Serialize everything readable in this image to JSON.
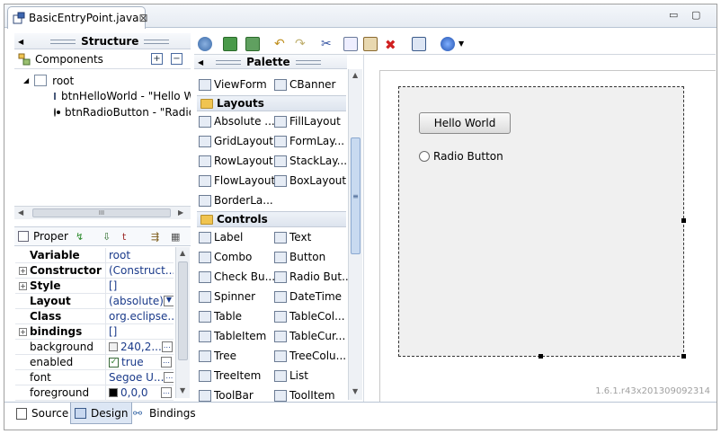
{
  "editor": {
    "tab_title": "BasicEntryPoint.java",
    "close_glyph": "⊠",
    "minimize_glyph": "▭",
    "maximize_glyph": "▢"
  },
  "structure": {
    "title": "Structure",
    "components_label": "Components",
    "tree": {
      "root_label": "root",
      "children": [
        {
          "label": "btnHelloWorld - \"Hello W",
          "icon": "button-icon"
        },
        {
          "label": "btnRadioButton - \"Radio",
          "icon": "radio-icon"
        }
      ]
    },
    "hscroll_grip": "III"
  },
  "properties": {
    "title": "Proper",
    "rows": [
      {
        "name": "Variable",
        "value": "root",
        "bold": true,
        "expand": false
      },
      {
        "name": "Constructor",
        "value": "(Construct...",
        "bold": true,
        "expand": true
      },
      {
        "name": "Style",
        "value": "[]",
        "bold": true,
        "expand": true
      },
      {
        "name": "Layout",
        "value": "(absolute)",
        "bold": true,
        "expand": false,
        "dropdown": true
      },
      {
        "name": "Class",
        "value": "org.eclipse....",
        "bold": true,
        "expand": false
      },
      {
        "name": "bindings",
        "value": "[]",
        "bold": true,
        "expand": true
      },
      {
        "name": "background",
        "value": "240,2...",
        "bold": false,
        "expand": false,
        "swatch": "#f0f0f0",
        "dots": true
      },
      {
        "name": "enabled",
        "value": "true",
        "bold": false,
        "expand": false,
        "checkbox": true,
        "dots": true
      },
      {
        "name": "font",
        "value": "Segoe U...",
        "bold": false,
        "expand": false,
        "dots": true
      },
      {
        "name": "foreground",
        "value": "0,0,0",
        "bold": false,
        "expand": false,
        "swatch": "#000000",
        "dots": true
      }
    ]
  },
  "palette": {
    "title": "Palette",
    "items_top": [
      {
        "left": "ViewForm",
        "right": "CBanner"
      }
    ],
    "layouts_label": "Layouts",
    "layouts": [
      {
        "left": "Absolute ...",
        "right": "FillLayout"
      },
      {
        "left": "GridLayout",
        "right": "FormLay..."
      },
      {
        "left": "RowLayout",
        "right": "StackLay..."
      },
      {
        "left": "FlowLayout",
        "right": "BoxLayout"
      },
      {
        "left": "BorderLa...",
        "right": ""
      }
    ],
    "controls_label": "Controls",
    "controls": [
      {
        "left": "Label",
        "right": "Text"
      },
      {
        "left": "Combo",
        "right": "Button"
      },
      {
        "left": "Check Bu...",
        "right": "Radio But..."
      },
      {
        "left": "Spinner",
        "right": "DateTime"
      },
      {
        "left": "Table",
        "right": "TableCol..."
      },
      {
        "left": "TableItem",
        "right": "TableCur..."
      },
      {
        "left": "Tree",
        "right": "TreeColu..."
      },
      {
        "left": "TreeItem",
        "right": "List"
      },
      {
        "left": "ToolBar",
        "right": "ToolItem"
      }
    ]
  },
  "design": {
    "hello_button": "Hello World",
    "radio_label": "Radio Button",
    "version": "1.6.1.r43x201309092314"
  },
  "bottom_tabs": {
    "source": "Source",
    "design": "Design",
    "bindings": "Bindings"
  }
}
